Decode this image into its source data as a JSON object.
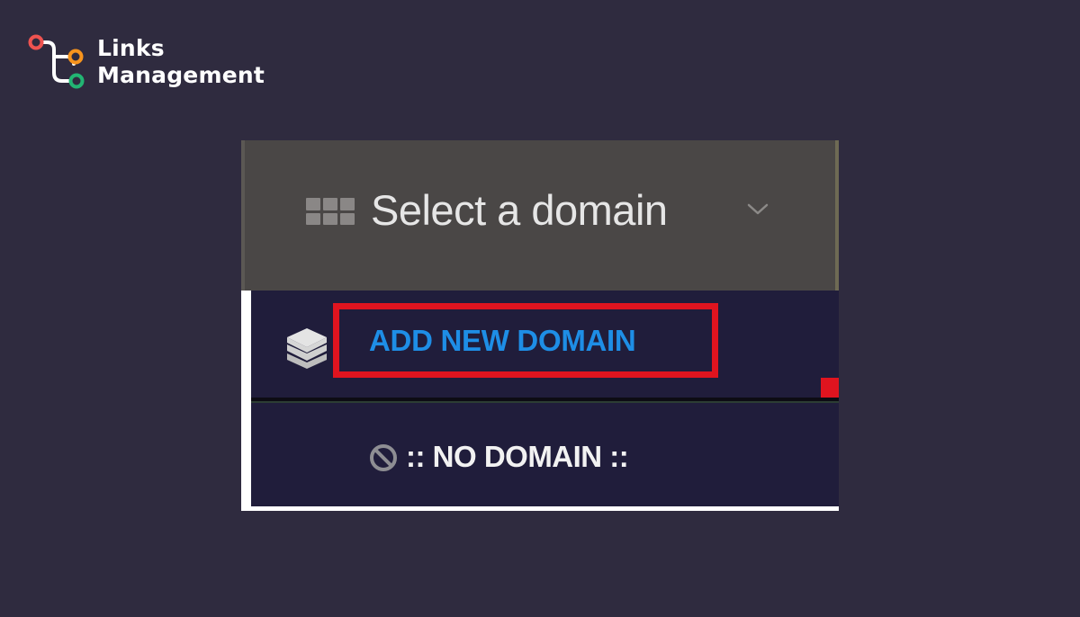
{
  "logo": {
    "line1": "Links",
    "line2": "Management",
    "icon": "links-path-icon",
    "colors": {
      "red": "#ef5350",
      "orange": "#f7941d",
      "green": "#22b573"
    }
  },
  "select": {
    "label": "Select a domain",
    "icon": "grid-icon",
    "chevron": "chevron-down-icon"
  },
  "dropdown": {
    "items": [
      {
        "label": "ADD NEW DOMAIN",
        "icon": "layers-icon",
        "highlighted": true
      },
      {
        "label": ":: NO DOMAIN ::",
        "icon": "ban-icon"
      }
    ]
  },
  "colors": {
    "background": "#2f2b3f",
    "header": "#4a4746",
    "dropdown": "#201d3b",
    "link": "#1e8ee6",
    "highlight": "#e0141f"
  }
}
